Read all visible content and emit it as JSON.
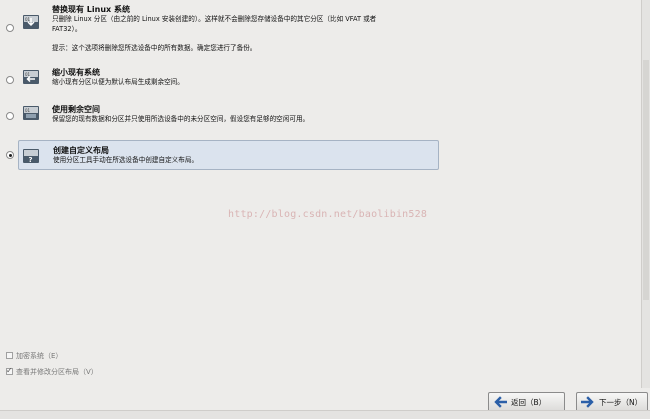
{
  "options": [
    {
      "title": "替换现有 Linux 系统",
      "desc_lines": [
        "只删除 Linux 分区（由之前的 Linux 安装创建的）。这样就不会删除您存储设备中的其它分区（比如 VFAT 或者",
        "FAT32）。"
      ],
      "note": "提示：这个选项将删除您所选设备中的所有数据。确定您进行了备份。",
      "icon": "disk-replace-icon",
      "selected": false
    },
    {
      "title": "缩小现有系统",
      "desc_lines": [
        "缩小现有分区以便为默认布局生成剩余空间。"
      ],
      "icon": "disk-shrink-icon",
      "selected": false
    },
    {
      "title": "使用剩余空间",
      "desc_lines": [
        "保留您的现有数据和分区并只使用所选设备中的未分区空间，假设您有足够的空闲可用。"
      ],
      "icon": "disk-free-space-icon",
      "selected": false
    },
    {
      "title": "创建自定义布局",
      "desc_lines": [
        "使用分区工具手动在所选设备中创建自定义布局。"
      ],
      "icon": "disk-custom-icon",
      "selected": true
    }
  ],
  "watermark": "http://blog.csdn.net/baolibin528",
  "checkboxes": [
    {
      "label": "加密系统（E）",
      "checked": false
    },
    {
      "label": "查看并修改分区布局（V）",
      "checked": true
    }
  ],
  "buttons": {
    "back_label": "返回（B）",
    "next_label": "下一步（N）"
  },
  "colors": {
    "background": "#edecea",
    "selected_bg": "#dbe3ee",
    "arrow_blue": "#2b5fa8"
  }
}
